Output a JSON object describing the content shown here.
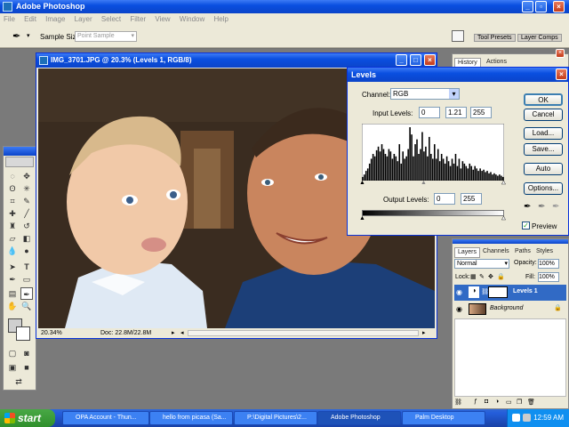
{
  "app": {
    "title": "Adobe Photoshop"
  },
  "menu": [
    "File",
    "Edit",
    "Image",
    "Layer",
    "Select",
    "Filter",
    "View",
    "Window",
    "Help"
  ],
  "options_bar": {
    "sample_size_label": "Sample Size:",
    "sample_size_value": "Point Sample",
    "tabs": [
      "Tool Presets",
      "Layer Comps"
    ]
  },
  "document": {
    "title": "IMG_3701.JPG @ 20.3% (Levels 1, RGB/8)",
    "zoom": "20.34%",
    "doc_size": "Doc: 22.8M/22.8M"
  },
  "history_panel": {
    "tabs": [
      "History",
      "Actions"
    ]
  },
  "levels": {
    "title": "Levels",
    "channel_label": "Channel:",
    "channel_value": "RGB",
    "input_levels_label": "Input Levels:",
    "input_levels": [
      "0",
      "1.21",
      "255"
    ],
    "output_levels_label": "Output Levels:",
    "output_levels": [
      "0",
      "255"
    ],
    "buttons": {
      "ok": "OK",
      "cancel": "Cancel",
      "load": "Load...",
      "save": "Save...",
      "auto": "Auto",
      "options": "Options..."
    },
    "preview_label": "Preview",
    "histogram": [
      3,
      5,
      8,
      10,
      14,
      18,
      22,
      20,
      25,
      28,
      24,
      30,
      26,
      22,
      20,
      26,
      24,
      18,
      22,
      20,
      16,
      30,
      14,
      24,
      18,
      20,
      26,
      44,
      38,
      20,
      30,
      34,
      22,
      26,
      40,
      24,
      28,
      20,
      36,
      22,
      18,
      30,
      18,
      26,
      16,
      22,
      18,
      14,
      20,
      16,
      12,
      18,
      14,
      22,
      12,
      18,
      10,
      16,
      14,
      12,
      10,
      14,
      12,
      9,
      12,
      10,
      8,
      10,
      8,
      9,
      7,
      8,
      6,
      7,
      5,
      6,
      5,
      4,
      5,
      4,
      3
    ]
  },
  "layers_panel": {
    "tabs": [
      "Layers",
      "Channels",
      "Paths",
      "Styles"
    ],
    "blend_mode": "Normal",
    "opacity_label": "Opacity:",
    "opacity_value": "100%",
    "lock_label": "Lock:",
    "fill_label": "Fill:",
    "fill_value": "100%",
    "layers": [
      {
        "name": "Levels 1",
        "selected": true
      },
      {
        "name": "Background",
        "selected": false
      }
    ]
  },
  "taskbar": {
    "start_label": "start",
    "tasks": [
      "OPA Account - Thun...",
      "hello from picasa (Sa...",
      "P:\\Digital Pictures\\2...",
      "Adobe Photoshop",
      "Palm Desktop"
    ],
    "clock": "12:59 AM"
  },
  "colors": {
    "xp_blue": "#0a4fe0",
    "selected_layer": "#316ac5"
  }
}
